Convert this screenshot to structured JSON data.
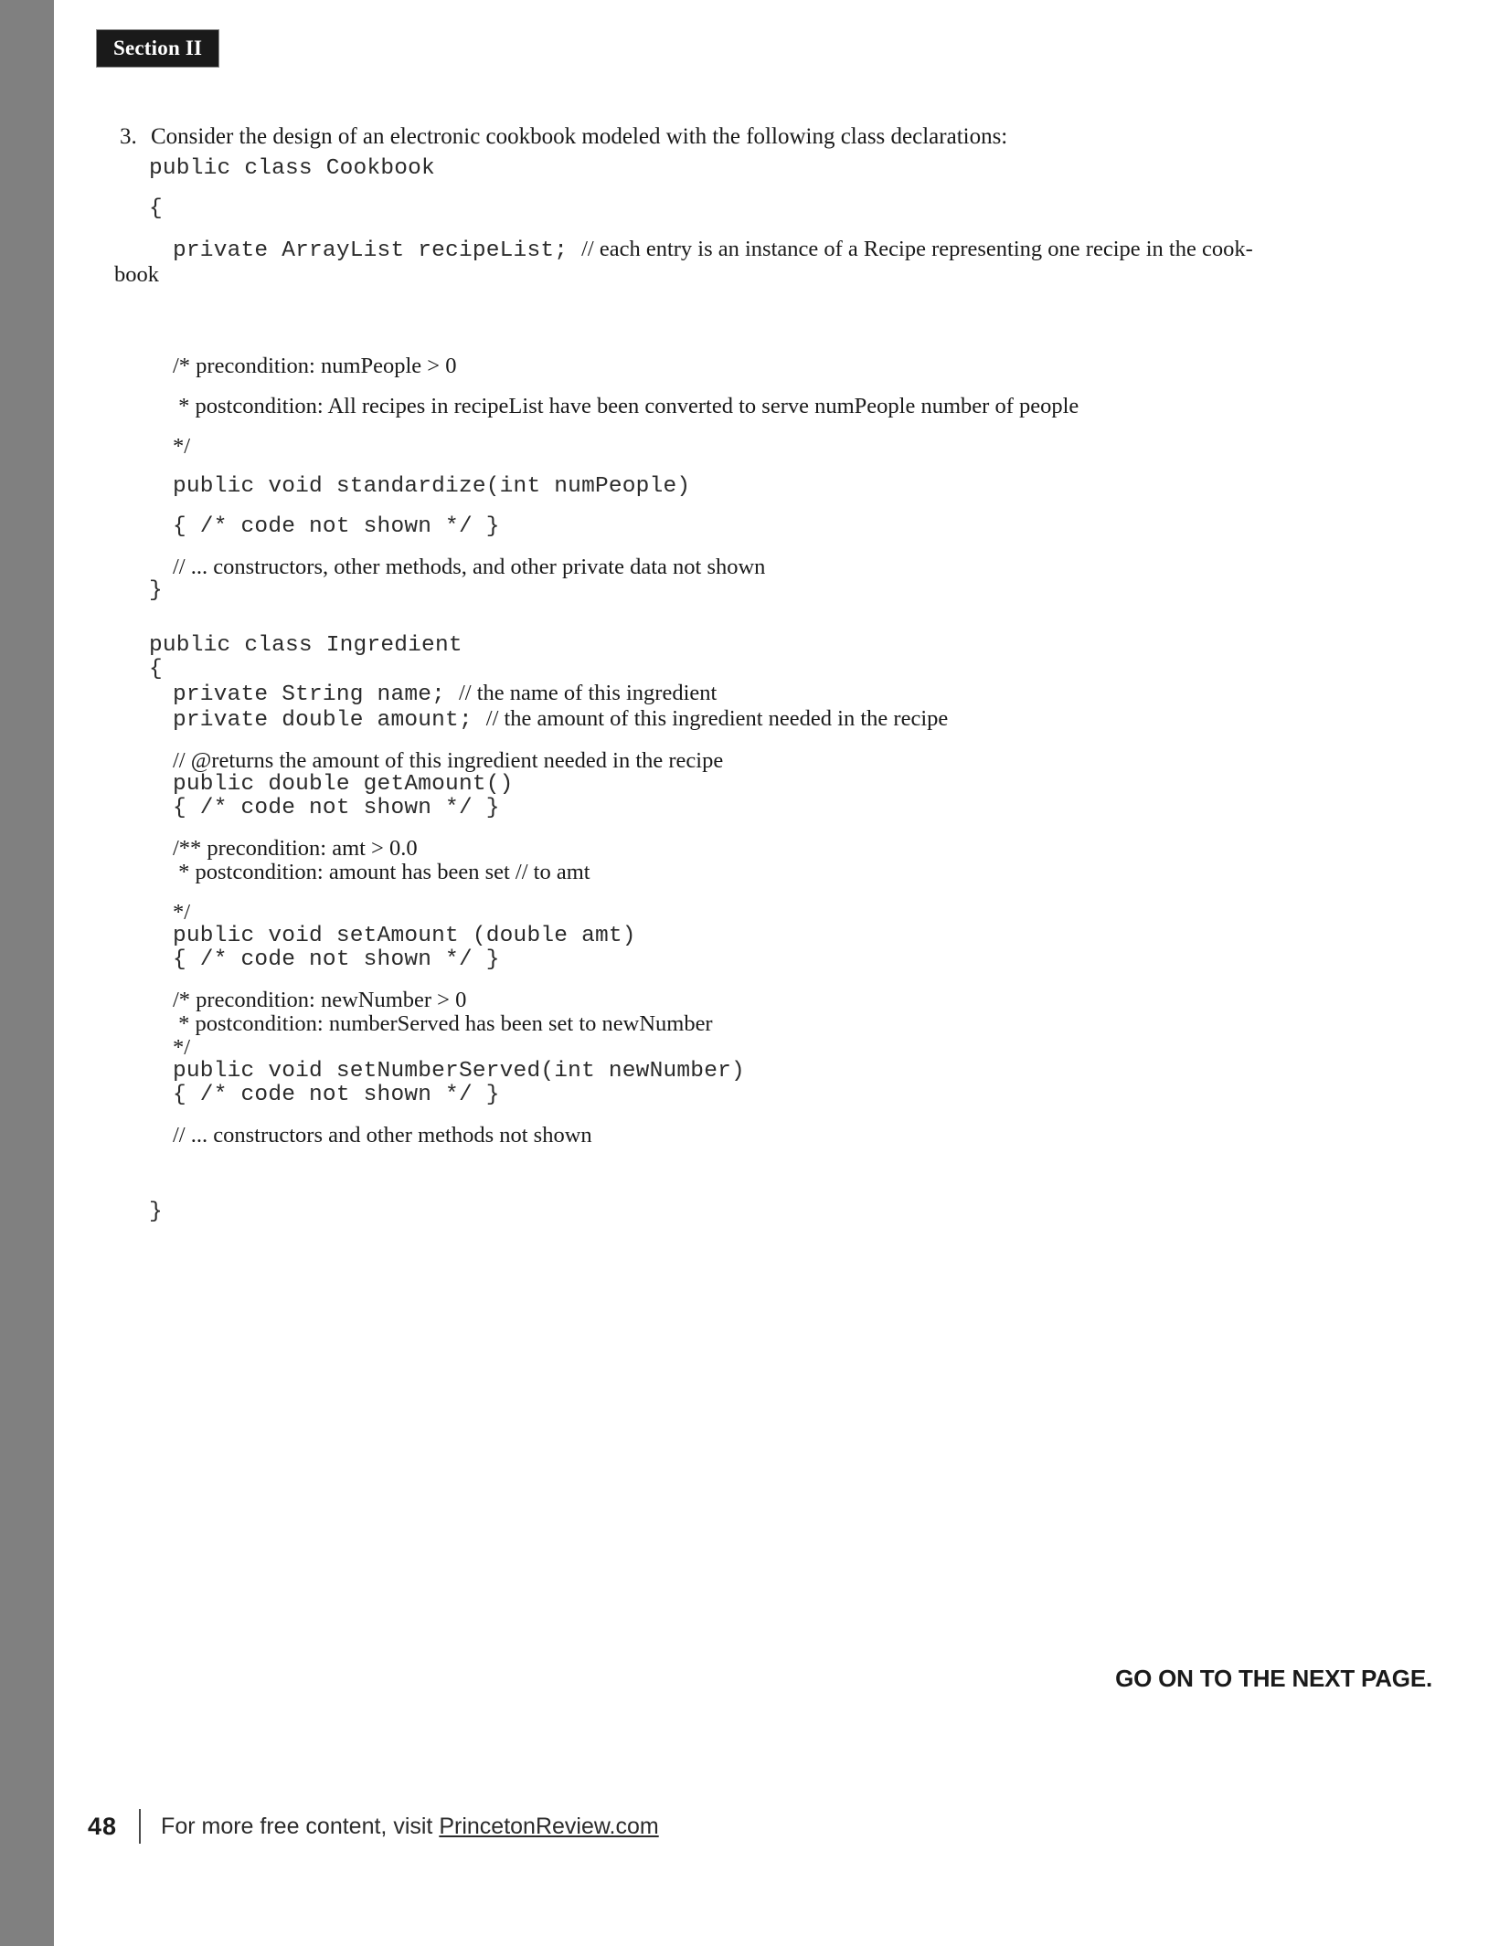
{
  "page": {
    "section_label": "Section II",
    "page_number": "48",
    "gutter_color": "#808080",
    "accent_color": "#1a1a1a"
  },
  "question": {
    "number": "3.",
    "text": "Consider the design of an electronic cookbook modeled with the following class declarations:"
  },
  "listing": {
    "lines": [
      {
        "kind": "code",
        "indent": 0,
        "text": "public class Cookbook"
      },
      {
        "kind": "space",
        "size": "sm"
      },
      {
        "kind": "code",
        "indent": 0,
        "text": "{"
      },
      {
        "kind": "space",
        "size": "sm"
      },
      {
        "kind": "mixed",
        "indent": 1,
        "mono": "private ArrayList recipeList; ",
        "serif": "// each entry is an instance of a Recipe representing one recipe in the cook-"
      },
      {
        "kind": "prose",
        "indent": 0,
        "wrap": true,
        "text": "book"
      },
      {
        "kind": "space",
        "size": "xl"
      },
      {
        "kind": "prose",
        "indent": 1,
        "text": "/* precondition: numPeople > 0"
      },
      {
        "kind": "space",
        "size": "sm"
      },
      {
        "kind": "prose",
        "indent": 1,
        "text": " * postcondition: All recipes in recipeList have been converted to serve numPeople number of people"
      },
      {
        "kind": "space",
        "size": "sm"
      },
      {
        "kind": "prose",
        "indent": 1,
        "text": "*/"
      },
      {
        "kind": "space",
        "size": "sm"
      },
      {
        "kind": "code",
        "indent": 1,
        "text": "public void standardize(int numPeople)"
      },
      {
        "kind": "space",
        "size": "sm"
      },
      {
        "kind": "code",
        "indent": 1,
        "text": "{ /* code not shown */ }"
      },
      {
        "kind": "space",
        "size": "sm"
      },
      {
        "kind": "prose",
        "indent": 1,
        "text": "// ... constructors, other methods, and other private data not shown"
      },
      {
        "kind": "code",
        "indent": 0,
        "text": "}"
      },
      {
        "kind": "space",
        "size": "md"
      },
      {
        "kind": "code",
        "indent": 0,
        "text": "public class Ingredient"
      },
      {
        "kind": "code",
        "indent": 0,
        "text": "{"
      },
      {
        "kind": "mixed",
        "indent": 1,
        "mono": "private String name; ",
        "serif": "// the name of this ingredient"
      },
      {
        "kind": "mixed",
        "indent": 1,
        "mono": "private double amount; ",
        "serif": "// the amount of this ingredient needed in the recipe"
      },
      {
        "kind": "space",
        "size": "sm"
      },
      {
        "kind": "prose",
        "indent": 1,
        "text": "// @returns the amount of this ingredient needed in the recipe"
      },
      {
        "kind": "code",
        "indent": 1,
        "text": "public double getAmount()"
      },
      {
        "kind": "code",
        "indent": 1,
        "text": "{ /* code not shown */ }"
      },
      {
        "kind": "space",
        "size": "sm"
      },
      {
        "kind": "prose",
        "indent": 1,
        "text": "/** precondition: amt > 0.0"
      },
      {
        "kind": "prose",
        "indent": 1,
        "text": " * postcondition: amount has been set // to amt"
      },
      {
        "kind": "space",
        "size": "sm"
      },
      {
        "kind": "prose",
        "indent": 1,
        "text": "*/"
      },
      {
        "kind": "code",
        "indent": 1,
        "text": "public void setAmount (double amt)"
      },
      {
        "kind": "code",
        "indent": 1,
        "text": "{ /* code not shown */ }"
      },
      {
        "kind": "space",
        "size": "sm"
      },
      {
        "kind": "prose",
        "indent": 1,
        "text": "/* precondition: newNumber > 0"
      },
      {
        "kind": "prose",
        "indent": 1,
        "text": " * postcondition: numberServed has been set to newNumber"
      },
      {
        "kind": "prose",
        "indent": 1,
        "text": "*/"
      },
      {
        "kind": "code",
        "indent": 1,
        "text": "public void setNumberServed(int newNumber)"
      },
      {
        "kind": "code",
        "indent": 1,
        "text": "{ /* code not shown */ }"
      },
      {
        "kind": "space",
        "size": "sm"
      },
      {
        "kind": "prose",
        "indent": 1,
        "text": "// ... constructors and other methods not shown"
      },
      {
        "kind": "space",
        "size": "lg"
      },
      {
        "kind": "code",
        "indent": 0,
        "text": "}"
      }
    ]
  },
  "notice": {
    "go_on": "GO ON TO THE NEXT PAGE."
  },
  "footer": {
    "page_number": "48",
    "text_before": "For more free content, visit ",
    "link_text": "PrincetonReview.com"
  }
}
